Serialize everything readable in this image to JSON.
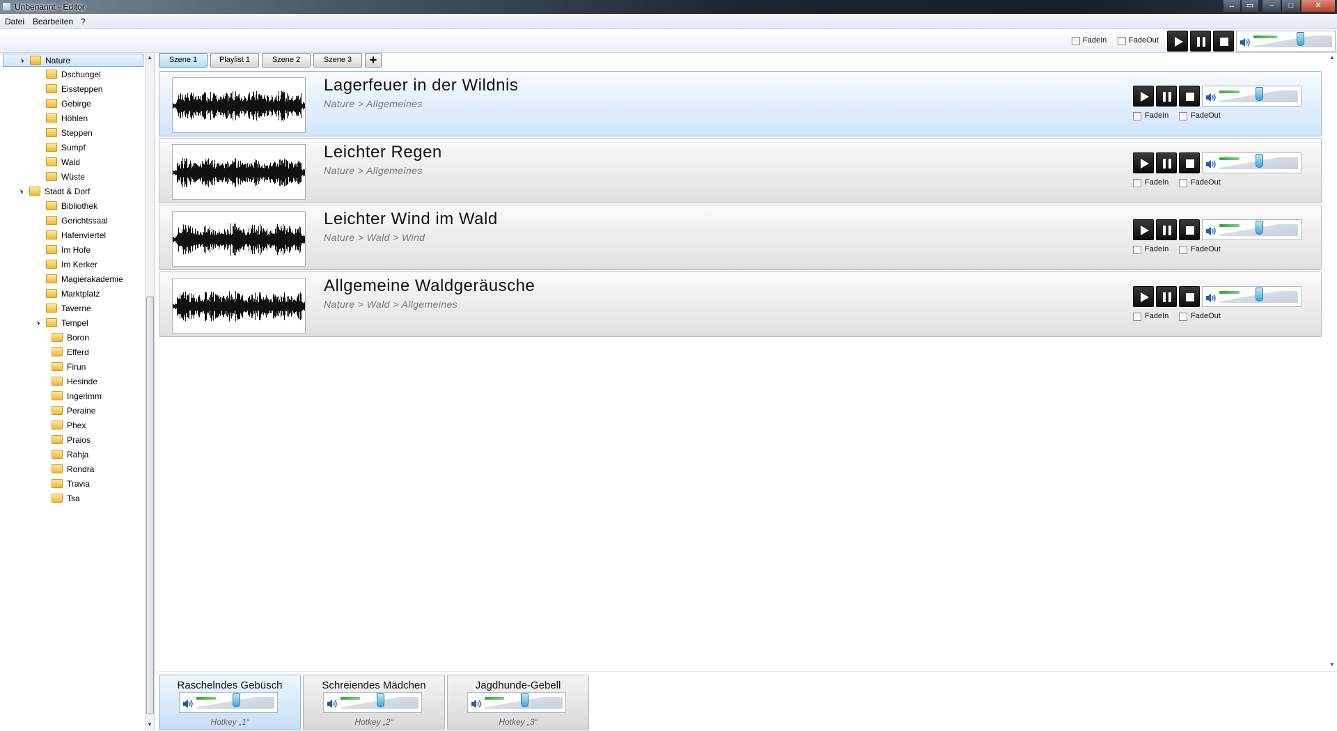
{
  "window": {
    "title": "Unbenannt - Editor"
  },
  "menu": {
    "items": [
      "Datei",
      "Bearbeiten",
      "?"
    ]
  },
  "global_controls": {
    "fadein_label": "FadeIn",
    "fadeout_label": "FadeOut",
    "fadein": false,
    "fadeout": false,
    "volume": 0.6
  },
  "tree": [
    {
      "label": "Nature",
      "level": 0,
      "expanded": true,
      "selected": true
    },
    {
      "label": "Dschungel",
      "level": 1
    },
    {
      "label": "Eissteppen",
      "level": 1
    },
    {
      "label": "Gebirge",
      "level": 1
    },
    {
      "label": "Höhlen",
      "level": 1
    },
    {
      "label": "Steppen",
      "level": 1
    },
    {
      "label": "Sumpf",
      "level": 1
    },
    {
      "label": "Wald",
      "level": 1
    },
    {
      "label": "Wüste",
      "level": 1
    },
    {
      "label": "Stadt & Dorf",
      "level": 0,
      "expanded": true
    },
    {
      "label": "Bibliothek",
      "level": 1
    },
    {
      "label": "Gerichtssaal",
      "level": 1
    },
    {
      "label": "Hafenviertel",
      "level": 1
    },
    {
      "label": "Im Hofe",
      "level": 1
    },
    {
      "label": "Im Kerker",
      "level": 1
    },
    {
      "label": "Magierakademie",
      "level": 1
    },
    {
      "label": "Marktplatz",
      "level": 1
    },
    {
      "label": "Taverne",
      "level": 1
    },
    {
      "label": "Tempel",
      "level": 1,
      "expanded": true
    },
    {
      "label": "Boron",
      "level": 2
    },
    {
      "label": "Efferd",
      "level": 2
    },
    {
      "label": "Firun",
      "level": 2
    },
    {
      "label": "Hesinde",
      "level": 2
    },
    {
      "label": "Ingerimm",
      "level": 2
    },
    {
      "label": "Peraine",
      "level": 2
    },
    {
      "label": "Phex",
      "level": 2
    },
    {
      "label": "Praios",
      "level": 2
    },
    {
      "label": "Rahja",
      "level": 2
    },
    {
      "label": "Rondra",
      "level": 2
    },
    {
      "label": "Travia",
      "level": 2
    },
    {
      "label": "Tsa",
      "level": 2
    }
  ],
  "tabs": [
    {
      "label": "Szene 1",
      "active": true
    },
    {
      "label": "Playlist 1"
    },
    {
      "label": "Szene 2"
    },
    {
      "label": "Szene 3"
    }
  ],
  "tab_add_label": "+",
  "sounds": [
    {
      "title": "Lagerfeuer in der Wildnis",
      "path": "Nature > Allgemeines",
      "active": true,
      "volume": 0.5,
      "fadein": false,
      "fadeout": false
    },
    {
      "title": "Leichter Regen",
      "path": "Nature > Allgemeines",
      "volume": 0.5,
      "fadein": false,
      "fadeout": false
    },
    {
      "title": "Leichter Wind im Wald",
      "path": "Nature > Wald > Wind",
      "volume": 0.5,
      "fadein": false,
      "fadeout": false
    },
    {
      "title": "Allgemeine Waldgeräusche",
      "path": "Nature > Wald > Allgemeines",
      "volume": 0.5,
      "fadein": false,
      "fadeout": false
    }
  ],
  "sound_labels": {
    "fadein": "FadeIn",
    "fadeout": "FadeOut"
  },
  "hotkeys": [
    {
      "title": "Raschelndes Gebüsch",
      "hotkey": "Hotkey „1“",
      "active": true,
      "volume": 0.5
    },
    {
      "title": "Schreiendes Mädchen",
      "hotkey": "Hotkey „2“",
      "volume": 0.5
    },
    {
      "title": "Jagdhunde-Gebell",
      "hotkey": "Hotkey „3“",
      "volume": 0.5
    }
  ],
  "icons": {
    "folder": "folder-icon",
    "speaker": "speaker-icon",
    "play": "play-icon",
    "pause": "pause-icon",
    "stop": "stop-icon"
  },
  "colors": {
    "accent": "#3aa8d8",
    "level_green": "#2ea82e",
    "selection_blue": "#cde5fc"
  }
}
